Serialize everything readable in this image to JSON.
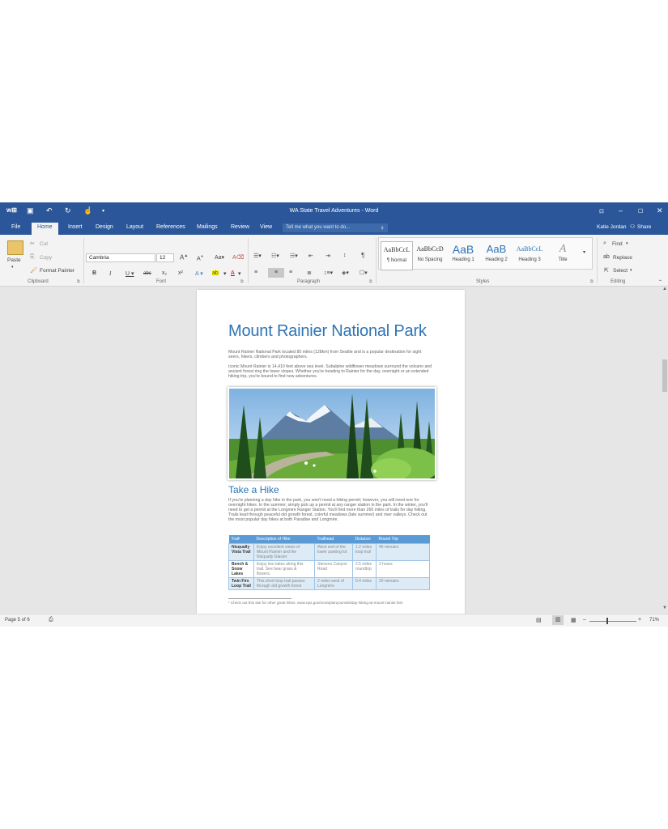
{
  "app": {
    "window_title": "WA State Travel Adventures - Word",
    "user": "Katie Jordan",
    "share": "Share",
    "tell_me": "Tell me what you want to do...",
    "tabs": [
      "File",
      "Home",
      "Insert",
      "Design",
      "Layout",
      "References",
      "Mailings",
      "Review",
      "View"
    ],
    "accent": "#2b579a",
    "heading_color": "#2e74b5"
  },
  "ribbon": {
    "clipboard": {
      "paste": "Paste",
      "cut": "Cut",
      "copy": "Copy",
      "format_painter": "Format Painter",
      "label": "Clipboard"
    },
    "font": {
      "name": "Cambria",
      "size": "12",
      "label": "Font"
    },
    "paragraph": {
      "label": "Paragraph"
    },
    "styles": {
      "label": "Styles",
      "items": [
        {
          "preview": "AaBbCcL",
          "name": "¶ Normal"
        },
        {
          "preview": "AaBbCcD",
          "name": "No Spacing"
        },
        {
          "preview": "AaB",
          "name": "Heading 1"
        },
        {
          "preview": "AaB",
          "name": "Heading 2"
        },
        {
          "preview": "AaBbCcL",
          "name": "Heading 3"
        },
        {
          "preview": "A",
          "name": "Title"
        }
      ]
    },
    "editing": {
      "find": "Find",
      "replace": "Replace",
      "select": "Select",
      "label": "Editing"
    }
  },
  "document": {
    "title": "Mount Rainier National Park",
    "intro_1": "Mount Rainier National Park located 80 miles (128km) from Seattle and is a popular destination for sight seers, hikers, climbers and photographers.",
    "intro_2": "Iconic Mount Rainier is 14,410 feet above sea level. Subalpine wildflower meadows surround the volcano and ancient forest ring the lower slopes. Whether you're heading to Rainier for the day, overnight or an extended hiking trip, you're bound to find new adventures.",
    "heading_2": "Take a Hike",
    "hike_para": "If you're planning a day hike in the park, you won't need a hiking permit; however, you will need one for overnight hikes. In the summer, simply pick up a permit at any ranger station in the park. In the winter, you'll need to get a permit at the Longmire Ranger Station. You'll find more than 260 miles of trails for day hiking. Trails lead through peaceful old growth forest, colorful meadows (late summer) and river valleys. Check out the most popular day hikes at both Paradise and Longmire.",
    "table": {
      "headers": [
        "Trail¹",
        "Description of Hike",
        "Trailhead",
        "Distance",
        "Round Trip"
      ],
      "rows": [
        [
          "Nisqually Vista Trail",
          "Enjoy excellent views of Mount Rainier and the Nisqually Glacier",
          "West end of the lower parking lot",
          "1.2 miles loop trail",
          "45 minutes"
        ],
        [
          "Bench & Snow Lakes",
          "Enjoy two lakes along this trail. See bear grass & flowers.",
          "Stevens Canyon Road",
          "2.5 miles roundtrip",
          "2 hours"
        ],
        [
          "Twin Firs Loop Trail",
          "This short loop trail passes through old growth forest",
          "2 miles west of Longmire",
          "0.4 miles",
          "20 minutes"
        ]
      ]
    },
    "footnote": "¹ Check out this site for other great hikes: www.nps.gov/mora/planyourvisit/day-hiking-at-mount-rainier.htm"
  },
  "status": {
    "page": "Page 5 of 6",
    "zoom": "71%"
  }
}
